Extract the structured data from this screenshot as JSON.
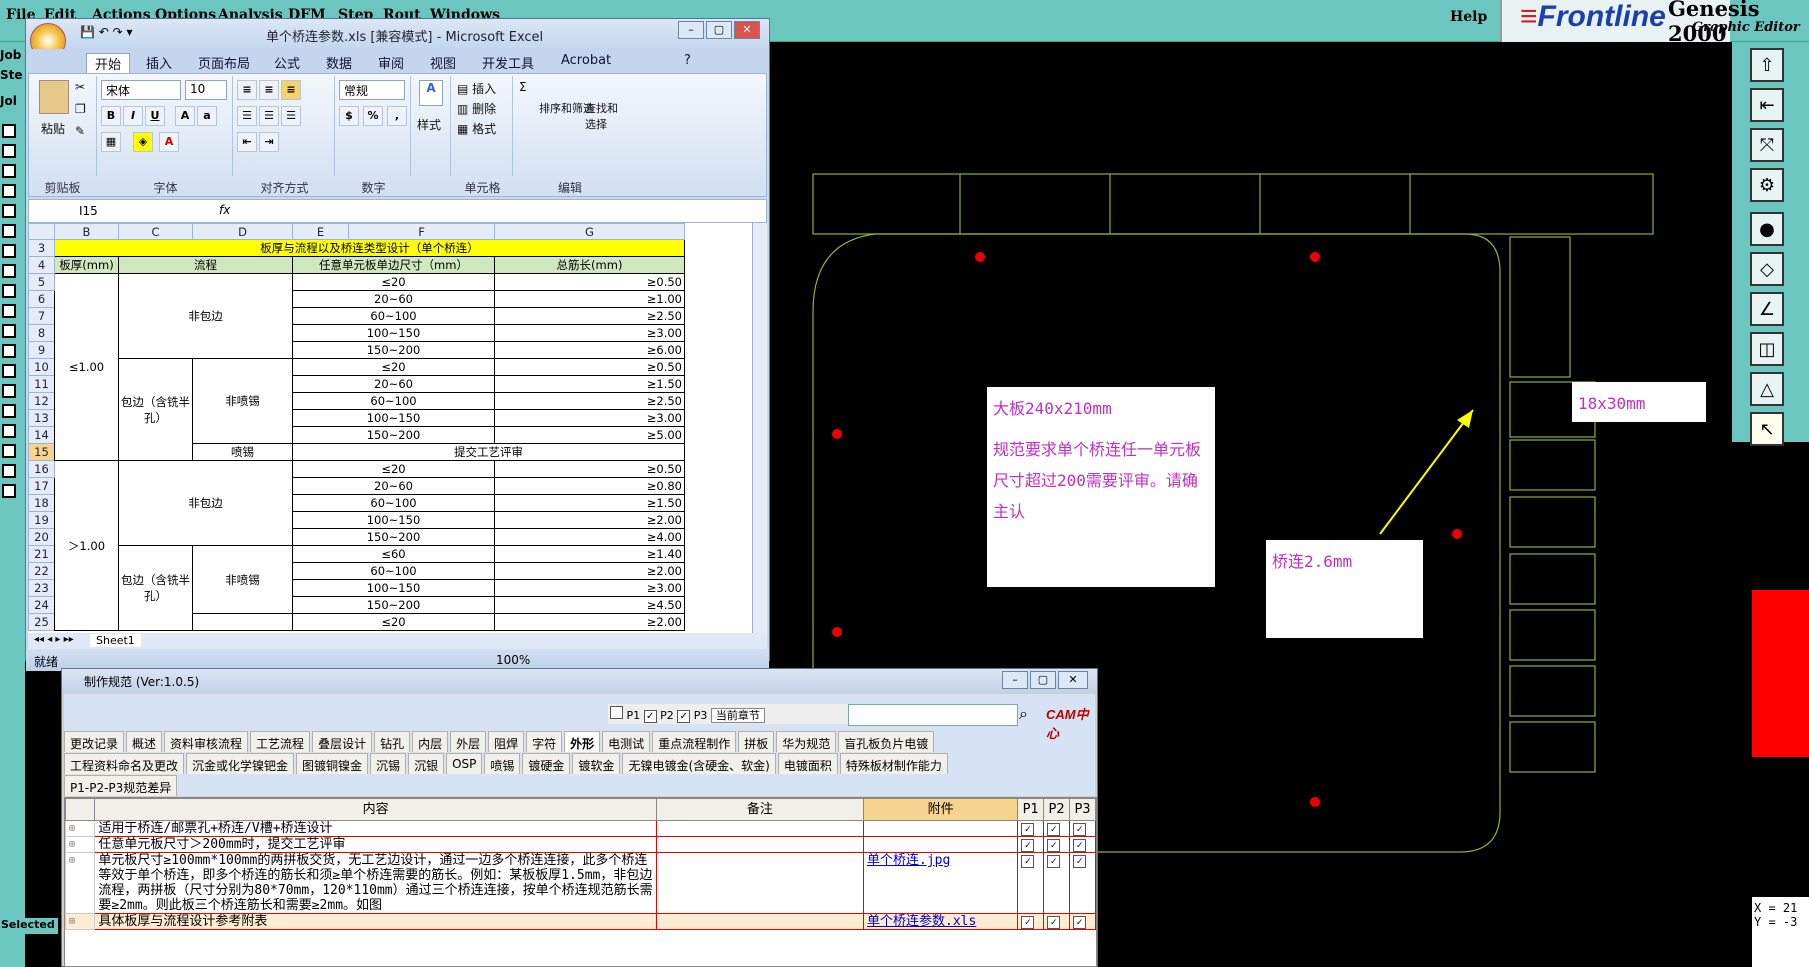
{
  "genesis": {
    "menu": [
      "File",
      "Edit",
      "Actions",
      "Options",
      "Analysis",
      "DFM",
      "Step",
      "Rout",
      "Windows"
    ],
    "help": "Help",
    "brand": "Frontline",
    "title": "Genesis 2000",
    "subtitle": "Graphic Editor",
    "left_labels": [
      "Job",
      "Ste",
      "Jol"
    ],
    "coords": [
      "X = 21",
      "Y = -3"
    ],
    "selected": "Selected"
  },
  "notes": {
    "board": "大板240x210mm",
    "rule": "规范要求单个桥连任一单元板尺寸超过200需要评审。请确主认",
    "unit": "18x30mm",
    "bridge": "桥连2.6mm"
  },
  "excel": {
    "title": "单个桥连参数.xls [兼容模式] - Microsoft Excel",
    "tabs": [
      "开始",
      "插入",
      "页面布局",
      "公式",
      "数据",
      "审阅",
      "视图",
      "开发工具",
      "Acrobat"
    ],
    "groups": [
      "剪贴板",
      "字体",
      "对齐方式",
      "数字",
      "单元格",
      "编辑"
    ],
    "paste": "粘贴",
    "font": "宋体",
    "size": "10",
    "numfmt": "常规",
    "style": "样式",
    "insert": "插入",
    "delete": "删除",
    "format": "格式",
    "sort": "排序和筛选",
    "find": "查找和选择",
    "cellref": "I15",
    "fx": "fx",
    "cols": [
      "B",
      "C",
      "D",
      "E",
      "F",
      "G"
    ],
    "title_row": "板厚与流程以及桥连类型设计（单个桥连）",
    "hdr": [
      "板厚(mm)",
      "流程",
      "任意单元板单边尺寸（mm）",
      "总筋长(mm)"
    ],
    "t1": "≤1.00",
    "t2": "＞1.00",
    "nowrap": "非包边",
    "wrap": "包边（含铣半孔）",
    "nospray": "非喷锡",
    "spray": "喷锡",
    "review": "提交工艺评审",
    "rows": [
      {
        "n": "5",
        "s": "≤20",
        "v": "≥0.50"
      },
      {
        "n": "6",
        "s": "20~60",
        "v": "≥1.00"
      },
      {
        "n": "7",
        "s": "60~100",
        "v": "≥2.50"
      },
      {
        "n": "8",
        "s": "100~150",
        "v": "≥3.00"
      },
      {
        "n": "9",
        "s": "150~200",
        "v": "≥6.00"
      },
      {
        "n": "10",
        "s": "≤20",
        "v": "≥0.50"
      },
      {
        "n": "11",
        "s": "20~60",
        "v": "≥1.50"
      },
      {
        "n": "12",
        "s": "60~100",
        "v": "≥2.50"
      },
      {
        "n": "13",
        "s": "100~150",
        "v": "≥3.00"
      },
      {
        "n": "14",
        "s": "150~200",
        "v": "≥5.00"
      },
      {
        "n": "16",
        "s": "≤20",
        "v": "≥0.50"
      },
      {
        "n": "17",
        "s": "20~60",
        "v": "≥0.80"
      },
      {
        "n": "18",
        "s": "60~100",
        "v": "≥1.50"
      },
      {
        "n": "19",
        "s": "100~150",
        "v": "≥2.00"
      },
      {
        "n": "20",
        "s": "150~200",
        "v": "≥4.00"
      },
      {
        "n": "21",
        "s": "≤60",
        "v": "≥1.40"
      },
      {
        "n": "22",
        "s": "60~100",
        "v": "≥2.00"
      },
      {
        "n": "23",
        "s": "100~150",
        "v": "≥3.00"
      },
      {
        "n": "24",
        "s": "150~200",
        "v": "≥4.50"
      },
      {
        "n": "25",
        "s": "≤20",
        "v": "≥2.00"
      }
    ],
    "sheet": "Sheet1",
    "status": "就绪",
    "zoom": "100%"
  },
  "spec": {
    "title": "制作规范 (Ver:1.0.5)",
    "filters": [
      "P1",
      "P2",
      "P3"
    ],
    "section": "当前章节",
    "cam": "CAM中心",
    "tabs1": [
      "更改记录",
      "概述",
      "资料审核流程",
      "工艺流程",
      "叠层设计",
      "钻孔",
      "内层",
      "外层",
      "阻焊",
      "字符",
      "外形",
      "电测试",
      "重点流程制作",
      "拼板",
      "华为规范",
      "盲孔板负片电镀"
    ],
    "tabs2": [
      "工程资料命名及更改",
      "沉金或化学镍钯金",
      "图镀铜镍金",
      "沉锡",
      "沉银",
      "OSP",
      "喷锡",
      "镀硬金",
      "镀软金",
      "无镍电镀金(含硬金、软金)",
      "电镀面积",
      "特殊板材制作能力"
    ],
    "tabs3": [
      "P1-P2-P3规范差异"
    ],
    "cols": [
      "内容",
      "备注",
      "附件",
      "P1",
      "P2",
      "P3"
    ],
    "rows": [
      {
        "c": "适用于桥连/邮票孔+桥连/V槽+桥连设计",
        "a": ""
      },
      {
        "c": "任意单元板尺寸＞200mm时，提交工艺评审",
        "a": ""
      },
      {
        "c": "单元板尺寸≥100mm*100mm的两拼板交货，无工艺边设计，通过一边多个桥连连接，此多个桥连等效于单个桥连，即多个桥连的筋长和须≥单个桥连需要的筋长。例如：某板板厚1.5mm，非包边流程，两拼板（尺寸分别为80*70mm，120*110mm）通过三个桥连连接，按单个桥连规范筋长需要≥2mm。则此板三个桥连筋长和需要≥2mm。如图",
        "a": "单个桥连.jpg"
      },
      {
        "c": "具体板厚与流程设计参考附表",
        "a": "单个桥连参数.xls"
      }
    ]
  }
}
